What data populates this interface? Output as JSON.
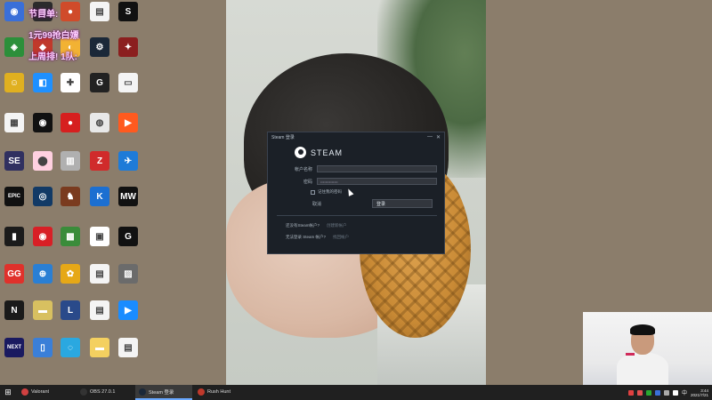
{
  "desktop_icons": [
    {
      "label": "",
      "color": "#3a6fd8",
      "glyph": "◉"
    },
    {
      "label": "",
      "color": "#2b2b2b",
      "glyph": "◼"
    },
    {
      "label": "",
      "color": "#d04b2a",
      "glyph": "●"
    },
    {
      "label": "",
      "color": "#f4f4f4",
      "glyph": "▤"
    },
    {
      "label": "",
      "color": "#111111",
      "glyph": "S"
    },
    {
      "label": "",
      "color": "#2c8f3a",
      "glyph": "◈"
    },
    {
      "label": "",
      "color": "#c0392b",
      "glyph": "◆"
    },
    {
      "label": "",
      "color": "#f2b233",
      "glyph": "◐"
    },
    {
      "label": "",
      "color": "#1b2838",
      "glyph": "⚙"
    },
    {
      "label": "",
      "color": "#8b1f1f",
      "glyph": "✦"
    },
    {
      "label": "",
      "color": "#e0b020",
      "glyph": "☺"
    },
    {
      "label": "",
      "color": "#1e90ff",
      "glyph": "◧"
    },
    {
      "label": "",
      "color": "#ffffff",
      "glyph": "✚"
    },
    {
      "label": "",
      "color": "#222222",
      "glyph": "G"
    },
    {
      "label": "",
      "color": "#f4f4f4",
      "glyph": "▭"
    },
    {
      "label": "",
      "color": "#f4f4f4",
      "glyph": "▦"
    },
    {
      "label": "",
      "color": "#111111",
      "glyph": "◉"
    },
    {
      "label": "",
      "color": "#d61f1f",
      "glyph": "●"
    },
    {
      "label": "",
      "color": "#e8e8e8",
      "glyph": "◍"
    },
    {
      "label": "",
      "color": "#ff5a1f",
      "glyph": "▶"
    },
    {
      "label": "",
      "color": "#303060",
      "glyph": "SE"
    },
    {
      "label": "",
      "color": "#ffd0e0",
      "glyph": "⬤"
    },
    {
      "label": "",
      "color": "#b0b0b0",
      "glyph": "▥"
    },
    {
      "label": "",
      "color": "#d02b2b",
      "glyph": "Z"
    },
    {
      "label": "",
      "color": "#1e7bd8",
      "glyph": "✈"
    },
    {
      "label": "",
      "color": "#111111",
      "glyph": "EPIC"
    },
    {
      "label": "",
      "color": "#123a66",
      "glyph": "◎"
    },
    {
      "label": "",
      "color": "#7a3b1f",
      "glyph": "♞"
    },
    {
      "label": "",
      "color": "#1c6fd1",
      "glyph": "K"
    },
    {
      "label": "",
      "color": "#111111",
      "glyph": "MW"
    },
    {
      "label": "",
      "color": "#1b1b1b",
      "glyph": "▮"
    },
    {
      "label": "",
      "color": "#d81f26",
      "glyph": "◉"
    },
    {
      "label": "",
      "color": "#3a8c3a",
      "glyph": "▩"
    },
    {
      "label": "",
      "color": "#ffffff",
      "glyph": "▣"
    },
    {
      "label": "",
      "color": "#111111",
      "glyph": "G"
    },
    {
      "label": "",
      "color": "#e0312b",
      "glyph": "GG"
    },
    {
      "label": "",
      "color": "#2a7fd4",
      "glyph": "⊕"
    },
    {
      "label": "",
      "color": "#e6a817",
      "glyph": "✿"
    },
    {
      "label": "",
      "color": "#f4f4f4",
      "glyph": "▤"
    },
    {
      "label": "",
      "color": "#6b6b6b",
      "glyph": "▨"
    },
    {
      "label": "",
      "color": "#1a1a1a",
      "glyph": "N"
    },
    {
      "label": "",
      "color": "#d8c060",
      "glyph": "▬"
    },
    {
      "label": "",
      "color": "#2a4a8a",
      "glyph": "L"
    },
    {
      "label": "",
      "color": "#f4f4f4",
      "glyph": "▤"
    },
    {
      "label": "",
      "color": "#1a8cff",
      "glyph": "▶"
    },
    {
      "label": "",
      "color": "#1a1a60",
      "glyph": "NEXT"
    },
    {
      "label": "",
      "color": "#3a7fd8",
      "glyph": "▯"
    },
    {
      "label": "",
      "color": "#2aa8e0",
      "glyph": "◌"
    },
    {
      "label": "",
      "color": "#f4d060",
      "glyph": "▬"
    },
    {
      "label": "",
      "color": "#f4f4f4",
      "glyph": "▤"
    }
  ],
  "overlay_texts": [
    "节目单:",
    "1元99抢白嫖",
    "上周排! 1队:"
  ],
  "steam_dialog": {
    "title": "Steam 登录",
    "logo": "STEAM",
    "account_label": "帐户名称",
    "account_value": "",
    "password_label": "密码",
    "password_value": "••••••••••••••",
    "remember_label": "记住我的密码",
    "cancel_label": "取消",
    "login_label": "登录",
    "no_account_label": "还没有Steam帐户?",
    "create_account": "创建新帐户",
    "forgot_label": "无法登录 Steam 帐户?",
    "recover": "找回帐户"
  },
  "taskbar": {
    "start_glyph": "⊞",
    "items": [
      {
        "label": "Valorant",
        "color": "#d04040",
        "active": false
      },
      {
        "label": "OBS 27.0.1",
        "color": "#333333",
        "active": false
      },
      {
        "label": "Steam 登录",
        "color": "#1b2838",
        "active": true
      },
      {
        "label": "Rush Hunt",
        "color": "#c0392b",
        "active": false
      }
    ],
    "tray_icons": [
      "#e04040",
      "#e05050",
      "#2aa830",
      "#3a6fd8",
      "#aaaaaa",
      "#ffffff"
    ],
    "ime": "中",
    "clock_time": "3:44",
    "clock_date": "2021/7/21"
  }
}
